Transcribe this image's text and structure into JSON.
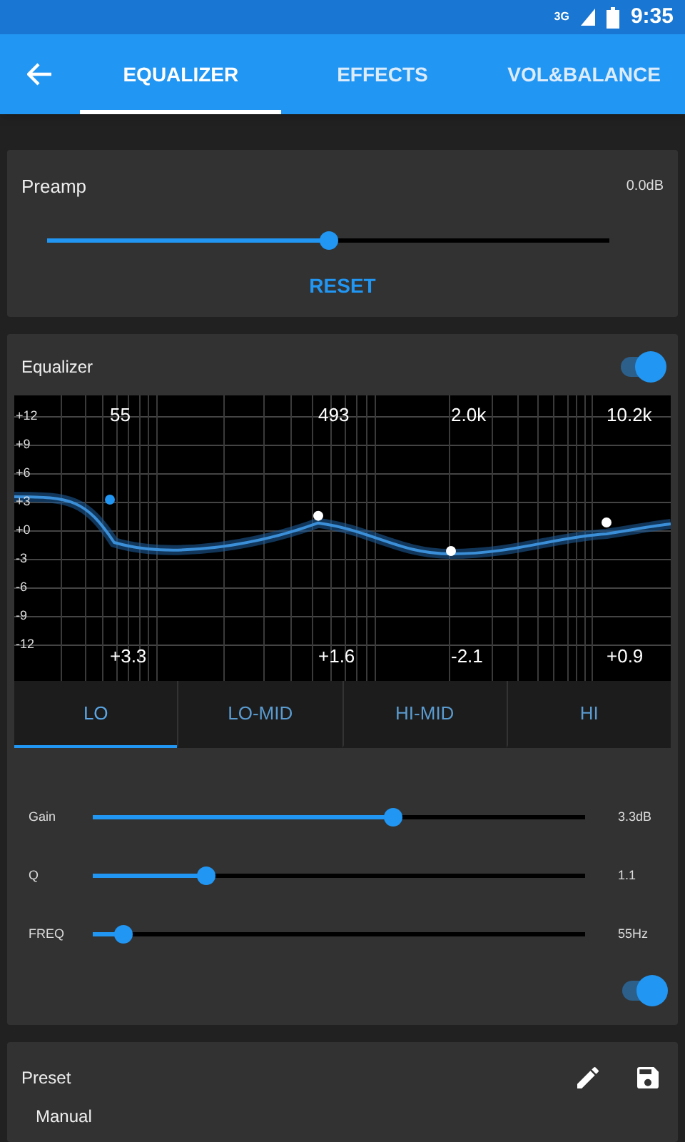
{
  "status_bar": {
    "network": "3G",
    "time": "9:35"
  },
  "tabs": [
    {
      "label": "EQUALIZER",
      "selected": true
    },
    {
      "label": "EFFECTS",
      "selected": false
    },
    {
      "label": "VOL&BALANCE",
      "selected": false
    }
  ],
  "preamp": {
    "label": "Preamp",
    "reading": "0.0dB",
    "level": 0.5,
    "reset": "RESET"
  },
  "equalizer": {
    "title": "Equalizer",
    "on": true,
    "yticks": [
      "+12",
      "+9",
      "+6",
      "+3",
      "+0",
      "-3",
      "-6",
      "-9",
      "-12"
    ],
    "bands": [
      {
        "freq": "55",
        "gain": "+3.3",
        "label": "LO",
        "selected": true
      },
      {
        "freq": "493",
        "gain": "+1.6",
        "label": "LO-MID",
        "selected": false
      },
      {
        "freq": "2.0k",
        "gain": "-2.1",
        "label": "HI-MID",
        "selected": false
      },
      {
        "freq": "10.2k",
        "gain": "+0.9",
        "label": "HI",
        "selected": false
      }
    ],
    "params": [
      {
        "label": "Gain",
        "level": 0.61,
        "reading": "3.3dB"
      },
      {
        "label": "Q",
        "level": 0.23,
        "reading": "1.1"
      },
      {
        "label": "FREQ",
        "level": 0.06,
        "reading": "55Hz"
      }
    ],
    "band_on": true
  },
  "preset": {
    "title": "Preset",
    "value": "Manual"
  }
}
